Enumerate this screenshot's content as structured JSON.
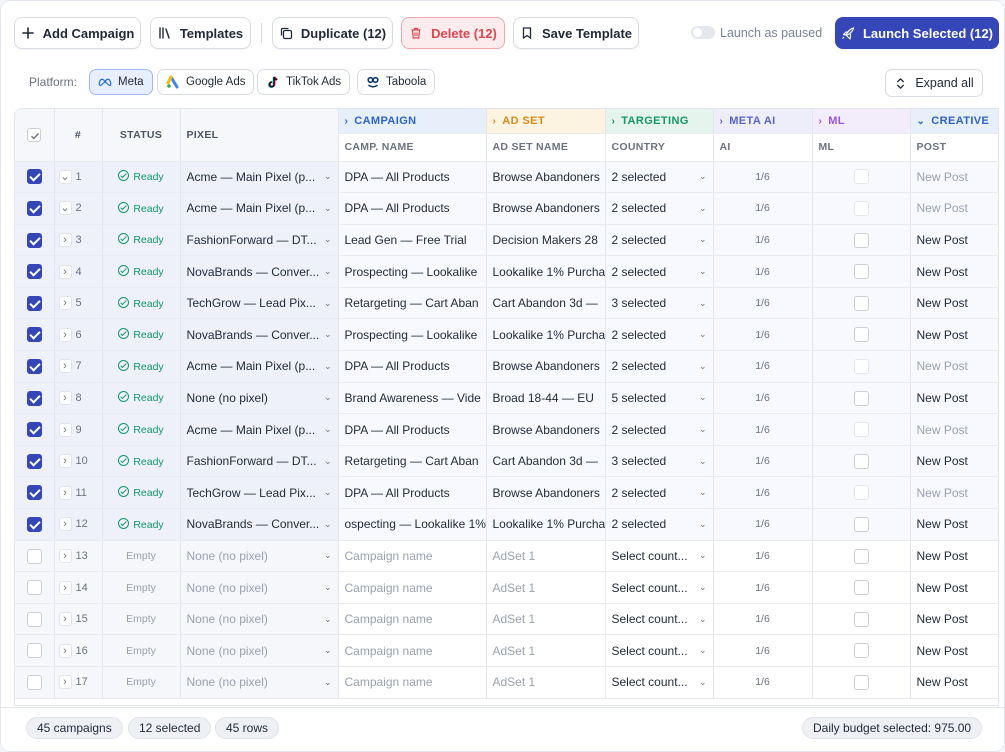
{
  "toolbar": {
    "add_campaign": "Add Campaign",
    "templates": "Templates",
    "duplicate": "Duplicate (12)",
    "delete": "Delete (12)",
    "save_template": "Save Template",
    "launch_paused_label": "Launch as paused",
    "launch_paused_on": false,
    "launch_selected": "Launch Selected (12)"
  },
  "platform": {
    "label": "Platform:",
    "options": [
      {
        "name": "Meta",
        "active": true
      },
      {
        "name": "Google Ads",
        "active": false
      },
      {
        "name": "TikTok Ads",
        "active": false
      },
      {
        "name": "Taboola",
        "active": false
      }
    ],
    "expand_all": "Expand all"
  },
  "columns": {
    "groups": {
      "campaign": "CAMPAIGN",
      "adset": "AD SET",
      "targeting": "TARGETING",
      "meta_ai": "META AI",
      "ml": "ML",
      "creative": "CREATIVE"
    },
    "num": "#",
    "status": "STATUS",
    "pixel": "PIXEL",
    "camp_name": "CAMP. NAME",
    "adset_name": "AD SET NAME",
    "country": "COUNTRY",
    "ai": "AI",
    "ml": "ML",
    "post": "POST"
  },
  "rows": [
    {
      "num": "1",
      "checked": true,
      "expanded": true,
      "status": "Ready",
      "pixel": "Acme — Main Pixel (p...",
      "campaign": "DPA — All Products",
      "adset": "Browse Abandoners",
      "country": "2 selected",
      "ai": "1/6",
      "post": "New Post",
      "post_muted": true
    },
    {
      "num": "2",
      "checked": true,
      "expanded": true,
      "status": "Ready",
      "pixel": "Acme — Main Pixel (p...",
      "campaign": "DPA — All Products",
      "adset": "Browse Abandoners",
      "country": "2 selected",
      "ai": "1/6",
      "post": "New Post",
      "post_muted": true
    },
    {
      "num": "3",
      "checked": true,
      "expanded": false,
      "status": "Ready",
      "pixel": "FashionForward — DT...",
      "campaign": "Lead Gen — Free Trial",
      "adset": "Decision Makers 28",
      "country": "2 selected",
      "ai": "1/6",
      "post": "New Post",
      "post_muted": false
    },
    {
      "num": "4",
      "checked": true,
      "expanded": false,
      "status": "Ready",
      "pixel": "NovaBrands — Conver...",
      "campaign": "Prospecting — Lookalike",
      "adset": "Lookalike 1% Purcha",
      "country": "2 selected",
      "ai": "1/6",
      "post": "New Post",
      "post_muted": false
    },
    {
      "num": "5",
      "checked": true,
      "expanded": false,
      "status": "Ready",
      "pixel": "TechGrow — Lead Pix...",
      "campaign": "Retargeting — Cart Aban",
      "adset": "Cart Abandon 3d —",
      "country": "3 selected",
      "ai": "1/6",
      "post": "New Post",
      "post_muted": false
    },
    {
      "num": "6",
      "checked": true,
      "expanded": false,
      "status": "Ready",
      "pixel": "NovaBrands — Conver...",
      "campaign": "Prospecting — Lookalike",
      "adset": "Lookalike 1% Purcha",
      "country": "2 selected",
      "ai": "1/6",
      "post": "New Post",
      "post_muted": false
    },
    {
      "num": "7",
      "checked": true,
      "expanded": false,
      "status": "Ready",
      "pixel": "Acme — Main Pixel (p...",
      "campaign": "DPA — All Products",
      "adset": "Browse Abandoners",
      "country": "2 selected",
      "ai": "1/6",
      "post": "New Post",
      "post_muted": true
    },
    {
      "num": "8",
      "checked": true,
      "expanded": false,
      "status": "Ready",
      "pixel": "None (no pixel)",
      "campaign": "Brand Awareness — Vide",
      "adset": "Broad 18-44 — EU",
      "country": "5 selected",
      "ai": "1/6",
      "post": "New Post",
      "post_muted": false
    },
    {
      "num": "9",
      "checked": true,
      "expanded": false,
      "status": "Ready",
      "pixel": "Acme — Main Pixel (p...",
      "campaign": "DPA — All Products",
      "adset": "Browse Abandoners",
      "country": "2 selected",
      "ai": "1/6",
      "post": "New Post",
      "post_muted": true
    },
    {
      "num": "10",
      "checked": true,
      "expanded": false,
      "status": "Ready",
      "pixel": "FashionForward — DT...",
      "campaign": "Retargeting — Cart Aban",
      "adset": "Cart Abandon 3d —",
      "country": "3 selected",
      "ai": "1/6",
      "post": "New Post",
      "post_muted": false
    },
    {
      "num": "11",
      "checked": true,
      "expanded": false,
      "status": "Ready",
      "pixel": "TechGrow — Lead Pix...",
      "campaign": "DPA — All Products",
      "adset": "Browse Abandoners",
      "country": "2 selected",
      "ai": "1/6",
      "post": "New Post",
      "post_muted": true
    },
    {
      "num": "12",
      "checked": true,
      "expanded": false,
      "status": "Ready",
      "pixel": "NovaBrands — Conver...",
      "campaign": "ospecting — Lookalike 1%",
      "adset": "Lookalike 1% Purcha",
      "country": "2 selected",
      "ai": "1/6",
      "post": "New Post",
      "post_muted": false
    },
    {
      "num": "13",
      "checked": false,
      "expanded": false,
      "status": "Empty",
      "pixel": "None (no pixel)",
      "campaign": "Campaign name",
      "adset": "AdSet 1",
      "country": "Select count...",
      "ai": "1/6",
      "post": "New Post",
      "post_muted": false
    },
    {
      "num": "14",
      "checked": false,
      "expanded": false,
      "status": "Empty",
      "pixel": "None (no pixel)",
      "campaign": "Campaign name",
      "adset": "AdSet 1",
      "country": "Select count...",
      "ai": "1/6",
      "post": "New Post",
      "post_muted": false
    },
    {
      "num": "15",
      "checked": false,
      "expanded": false,
      "status": "Empty",
      "pixel": "None (no pixel)",
      "campaign": "Campaign name",
      "adset": "AdSet 1",
      "country": "Select count...",
      "ai": "1/6",
      "post": "New Post",
      "post_muted": false
    },
    {
      "num": "16",
      "checked": false,
      "expanded": false,
      "status": "Empty",
      "pixel": "None (no pixel)",
      "campaign": "Campaign name",
      "adset": "AdSet 1",
      "country": "Select count...",
      "ai": "1/6",
      "post": "New Post",
      "post_muted": false
    },
    {
      "num": "17",
      "checked": false,
      "expanded": false,
      "status": "Empty",
      "pixel": "None (no pixel)",
      "campaign": "Campaign name",
      "adset": "AdSet 1",
      "country": "Select count...",
      "ai": "1/6",
      "post": "New Post",
      "post_muted": false
    }
  ],
  "footer": {
    "campaigns": "45 campaigns",
    "selected": "12 selected",
    "rows": "45 rows",
    "budget": "Daily budget selected: 975.00"
  },
  "colors": {
    "primary": "#3446b8",
    "danger": "#e0454f",
    "ready": "#15966a",
    "campaign_group": "#2d63c8",
    "adset_group": "#d98a1c",
    "targeting_group": "#15966a",
    "meta_ai_group": "#5b63c9",
    "ml_group": "#9a55d6"
  }
}
